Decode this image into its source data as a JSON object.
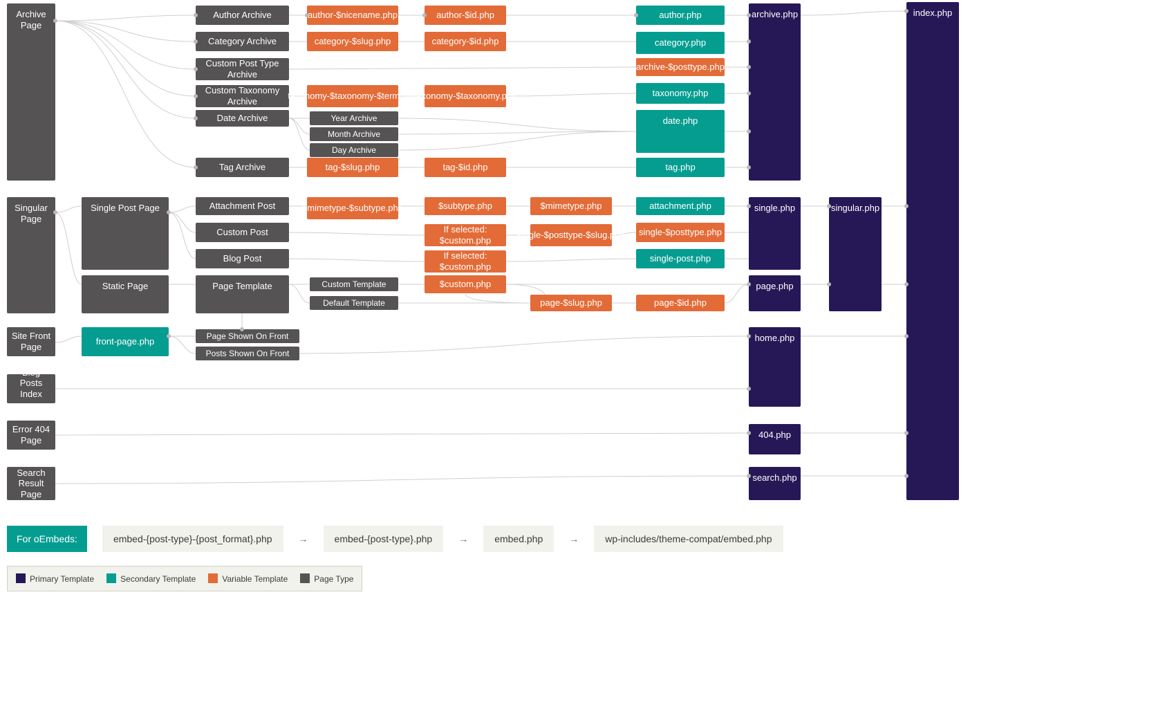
{
  "colors": {
    "gray": "#555353",
    "orange": "#e36b37",
    "teal": "#069d91",
    "navy": "#261857",
    "panel": "#f2f2ed",
    "connector": "#cfcfcf"
  },
  "labels": {
    "archive_page": "Archive Page",
    "singular_page": "Singular Page",
    "site_front_page": "Site Front Page",
    "blog_posts_index_page": "Blog Posts Index page",
    "error_404_page": "Error 404 Page",
    "search_result_page": "Search Result Page",
    "single_post_page": "Single Post Page",
    "static_page": "Static Page",
    "front_page_php": "front-page.php",
    "author_archive": "Author Archive",
    "category_archive": "Category Archive",
    "custom_post_type_archive": "Custom Post Type Archive",
    "custom_taxonomy_archive": "Custom Taxonomy Archive",
    "date_archive": "Date Archive",
    "tag_archive": "Tag Archive",
    "attachment_post": "Attachment Post",
    "custom_post": "Custom Post",
    "blog_post": "Blog Post",
    "page_template": "Page Template",
    "page_shown_on_front": "Page Shown On Front",
    "posts_shown_on_front": "Posts Shown On Front",
    "year_archive": "Year Archive",
    "month_archive": "Month Archive",
    "day_archive": "Day Archive",
    "custom_template": "Custom Template",
    "default_template": "Default Template",
    "author_nicename_php": "author-$nicename.php",
    "category_slug_php": "category-$slug.php",
    "taxonomy_term_php": "taxonomy-$taxonomy-$term.php",
    "tag_slug_php": "tag-$slug.php",
    "mimetype_subtype_php": "$mimetype-$subtype.php",
    "author_id_php": "author-$id.php",
    "category_id_php": "category-$id.php",
    "taxonomy_taxonomy_php": "taxonomy-$taxonomy.php",
    "tag_id_php": "tag-$id.php",
    "subtype_php": "$subtype.php",
    "if_selected_custom_php": "If selected: $custom.php",
    "custom_php": "$custom.php",
    "mimetype_php": "$mimetype.php",
    "single_posttype_slug_php": "single-$posttype-$slug.php",
    "page_slug_php": "page-$slug.php",
    "archive_posttype_php": "archive-$posttype.php",
    "single_posttype_php": "single-$posttype.php",
    "author_php": "author.php",
    "category_php": "category.php",
    "taxonomy_php": "taxonomy.php",
    "date_php": "date.php",
    "tag_php": "tag.php",
    "attachment_php": "attachment.php",
    "single_post_php": "single-post.php",
    "page_id_php": "page-$id.php",
    "archive_php": "archive.php",
    "single_php": "single.php",
    "page_php": "page.php",
    "home_php": "home.php",
    "404_php": "404.php",
    "search_php": "search.php",
    "singular_php": "singular.php",
    "index_php": "index.php"
  },
  "oembed": {
    "title": "For oEmbeds:",
    "steps": [
      "embed-{post-type}-{post_format}.php",
      "embed-{post-type}.php",
      "embed.php",
      "wp-includes/theme-compat/embed.php"
    ]
  },
  "legend": {
    "primary": "Primary Template",
    "secondary": "Secondary Template",
    "variable": "Variable Template",
    "page_type": "Page Type"
  }
}
